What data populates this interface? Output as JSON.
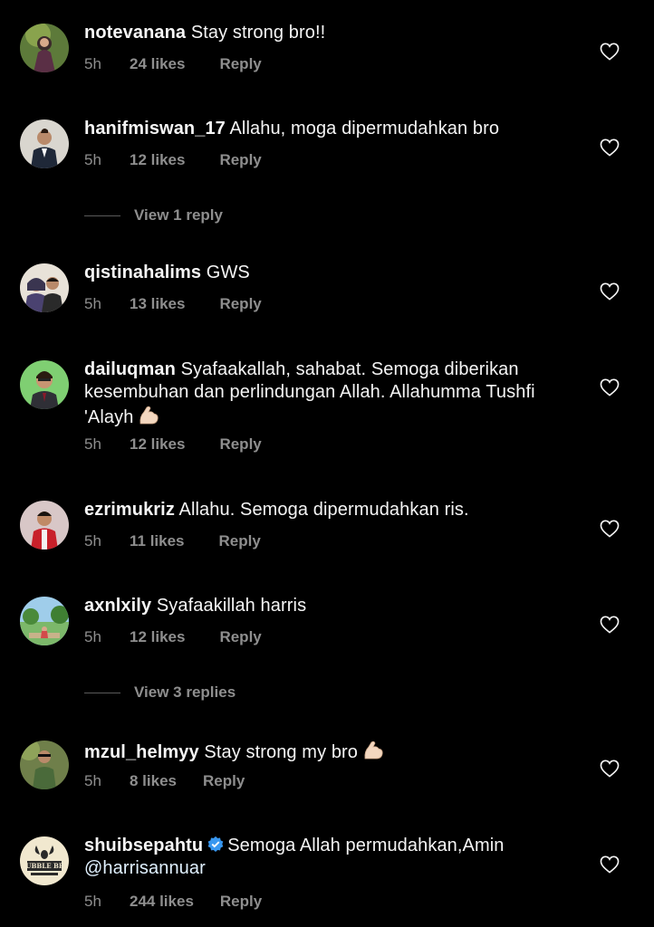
{
  "colors": {
    "background": "#000000",
    "primary_text": "#f5f5f5",
    "secondary_text": "#8e8e8e",
    "verified_blue": "#3897f0"
  },
  "icons": {
    "like": "heart-outline-icon",
    "verified": "verified-badge-icon",
    "emoji_flexed_biceps": "flexed-biceps-emoji"
  },
  "comments": [
    {
      "username": "notevanana",
      "text": "Stay strong bro!!",
      "time": "5h",
      "likes": "24 likes",
      "reply": "Reply"
    },
    {
      "username": "hanifmiswan_17",
      "text": "Allahu, moga dipermudahkan bro",
      "time": "5h",
      "likes": "12 likes",
      "reply": "Reply",
      "view_replies": "View 1 reply"
    },
    {
      "username": "qistinahalims",
      "text": "GWS",
      "time": "5h",
      "likes": "13 likes",
      "reply": "Reply"
    },
    {
      "username": "dailuqman",
      "text": "Syafaakallah, sahabat. Semoga diberikan kesembuhan dan perlindungan Allah. Allahumma Tushfi 'Alayh",
      "time": "5h",
      "likes": "12 likes",
      "reply": "Reply"
    },
    {
      "username": "ezrimukriz",
      "text": "Allahu. Semoga dipermudahkan ris.",
      "time": "5h",
      "likes": "11 likes",
      "reply": "Reply"
    },
    {
      "username": "axnlxily",
      "text": "Syafaakillah harris",
      "time": "5h",
      "likes": "12 likes",
      "reply": "Reply",
      "view_replies": "View 3 replies"
    },
    {
      "username": "mzul_helmyy",
      "text": "Stay strong my bro",
      "time": "5h",
      "likes": "8 likes",
      "reply": "Reply"
    },
    {
      "username": "shuibsepahtu",
      "text": "Semoga Allah permudahkan,Amin",
      "mention": "@harrisannuar",
      "time": "5h",
      "likes": "244 likes",
      "reply": "Reply",
      "avatar_text": "BUBBLE BEE"
    }
  ]
}
